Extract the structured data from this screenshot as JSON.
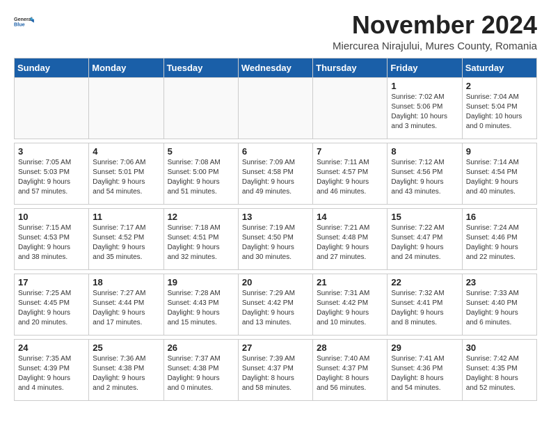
{
  "logo": {
    "line1": "General",
    "line2": "Blue"
  },
  "title": "November 2024",
  "subtitle": "Miercurea Nirajului, Mures County, Romania",
  "weekdays": [
    "Sunday",
    "Monday",
    "Tuesday",
    "Wednesday",
    "Thursday",
    "Friday",
    "Saturday"
  ],
  "weeks": [
    [
      {
        "day": "",
        "info": ""
      },
      {
        "day": "",
        "info": ""
      },
      {
        "day": "",
        "info": ""
      },
      {
        "day": "",
        "info": ""
      },
      {
        "day": "",
        "info": ""
      },
      {
        "day": "1",
        "info": "Sunrise: 7:02 AM\nSunset: 5:06 PM\nDaylight: 10 hours\nand 3 minutes."
      },
      {
        "day": "2",
        "info": "Sunrise: 7:04 AM\nSunset: 5:04 PM\nDaylight: 10 hours\nand 0 minutes."
      }
    ],
    [
      {
        "day": "3",
        "info": "Sunrise: 7:05 AM\nSunset: 5:03 PM\nDaylight: 9 hours\nand 57 minutes."
      },
      {
        "day": "4",
        "info": "Sunrise: 7:06 AM\nSunset: 5:01 PM\nDaylight: 9 hours\nand 54 minutes."
      },
      {
        "day": "5",
        "info": "Sunrise: 7:08 AM\nSunset: 5:00 PM\nDaylight: 9 hours\nand 51 minutes."
      },
      {
        "day": "6",
        "info": "Sunrise: 7:09 AM\nSunset: 4:58 PM\nDaylight: 9 hours\nand 49 minutes."
      },
      {
        "day": "7",
        "info": "Sunrise: 7:11 AM\nSunset: 4:57 PM\nDaylight: 9 hours\nand 46 minutes."
      },
      {
        "day": "8",
        "info": "Sunrise: 7:12 AM\nSunset: 4:56 PM\nDaylight: 9 hours\nand 43 minutes."
      },
      {
        "day": "9",
        "info": "Sunrise: 7:14 AM\nSunset: 4:54 PM\nDaylight: 9 hours\nand 40 minutes."
      }
    ],
    [
      {
        "day": "10",
        "info": "Sunrise: 7:15 AM\nSunset: 4:53 PM\nDaylight: 9 hours\nand 38 minutes."
      },
      {
        "day": "11",
        "info": "Sunrise: 7:17 AM\nSunset: 4:52 PM\nDaylight: 9 hours\nand 35 minutes."
      },
      {
        "day": "12",
        "info": "Sunrise: 7:18 AM\nSunset: 4:51 PM\nDaylight: 9 hours\nand 32 minutes."
      },
      {
        "day": "13",
        "info": "Sunrise: 7:19 AM\nSunset: 4:50 PM\nDaylight: 9 hours\nand 30 minutes."
      },
      {
        "day": "14",
        "info": "Sunrise: 7:21 AM\nSunset: 4:48 PM\nDaylight: 9 hours\nand 27 minutes."
      },
      {
        "day": "15",
        "info": "Sunrise: 7:22 AM\nSunset: 4:47 PM\nDaylight: 9 hours\nand 24 minutes."
      },
      {
        "day": "16",
        "info": "Sunrise: 7:24 AM\nSunset: 4:46 PM\nDaylight: 9 hours\nand 22 minutes."
      }
    ],
    [
      {
        "day": "17",
        "info": "Sunrise: 7:25 AM\nSunset: 4:45 PM\nDaylight: 9 hours\nand 20 minutes."
      },
      {
        "day": "18",
        "info": "Sunrise: 7:27 AM\nSunset: 4:44 PM\nDaylight: 9 hours\nand 17 minutes."
      },
      {
        "day": "19",
        "info": "Sunrise: 7:28 AM\nSunset: 4:43 PM\nDaylight: 9 hours\nand 15 minutes."
      },
      {
        "day": "20",
        "info": "Sunrise: 7:29 AM\nSunset: 4:42 PM\nDaylight: 9 hours\nand 13 minutes."
      },
      {
        "day": "21",
        "info": "Sunrise: 7:31 AM\nSunset: 4:42 PM\nDaylight: 9 hours\nand 10 minutes."
      },
      {
        "day": "22",
        "info": "Sunrise: 7:32 AM\nSunset: 4:41 PM\nDaylight: 9 hours\nand 8 minutes."
      },
      {
        "day": "23",
        "info": "Sunrise: 7:33 AM\nSunset: 4:40 PM\nDaylight: 9 hours\nand 6 minutes."
      }
    ],
    [
      {
        "day": "24",
        "info": "Sunrise: 7:35 AM\nSunset: 4:39 PM\nDaylight: 9 hours\nand 4 minutes."
      },
      {
        "day": "25",
        "info": "Sunrise: 7:36 AM\nSunset: 4:38 PM\nDaylight: 9 hours\nand 2 minutes."
      },
      {
        "day": "26",
        "info": "Sunrise: 7:37 AM\nSunset: 4:38 PM\nDaylight: 9 hours\nand 0 minutes."
      },
      {
        "day": "27",
        "info": "Sunrise: 7:39 AM\nSunset: 4:37 PM\nDaylight: 8 hours\nand 58 minutes."
      },
      {
        "day": "28",
        "info": "Sunrise: 7:40 AM\nSunset: 4:37 PM\nDaylight: 8 hours\nand 56 minutes."
      },
      {
        "day": "29",
        "info": "Sunrise: 7:41 AM\nSunset: 4:36 PM\nDaylight: 8 hours\nand 54 minutes."
      },
      {
        "day": "30",
        "info": "Sunrise: 7:42 AM\nSunset: 4:35 PM\nDaylight: 8 hours\nand 52 minutes."
      }
    ]
  ]
}
